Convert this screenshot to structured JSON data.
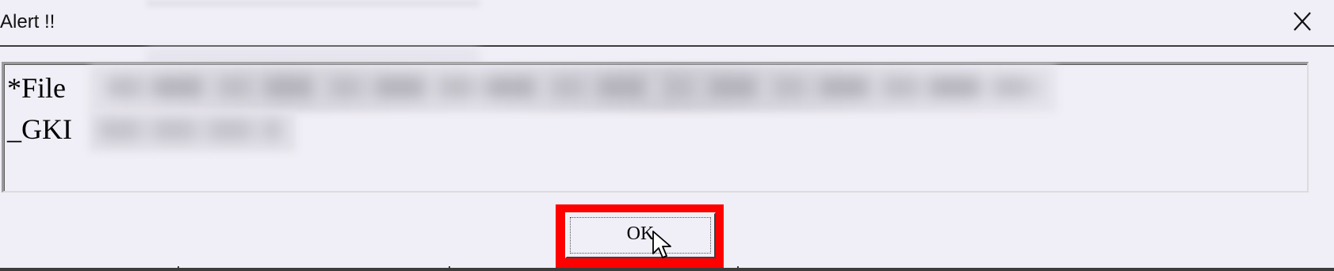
{
  "dialog": {
    "title": "Alert !!",
    "close_icon": "close-icon",
    "message_line1": "*File",
    "message_line2": "_GKI",
    "ok_label": "OK"
  },
  "colors": {
    "background": "#f0eef6",
    "highlight": "#ff0000"
  }
}
